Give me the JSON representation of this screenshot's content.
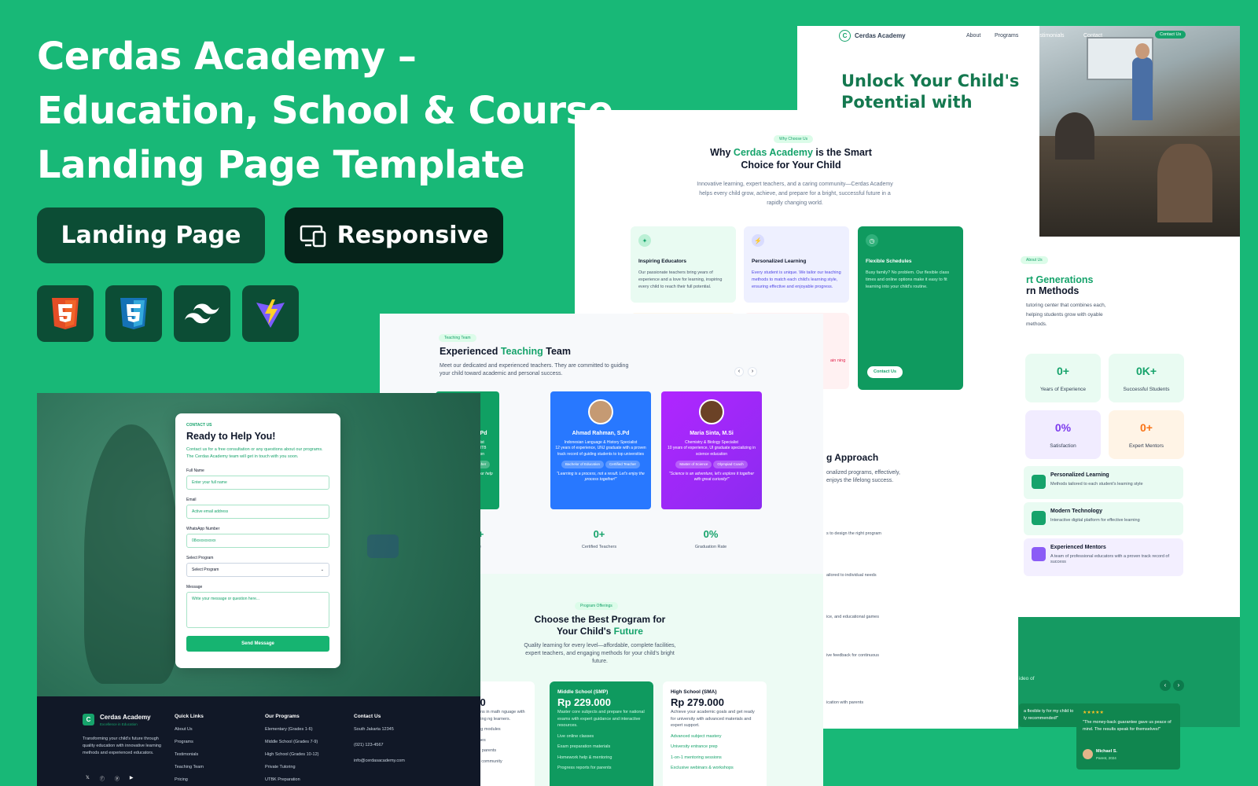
{
  "hero": {
    "title": "Cerdas Academy – Education, School & Course Landing Page Template",
    "badge_landing": "Landing Page",
    "badge_responsive": "Responsive"
  },
  "tech_icons": [
    "html5-icon",
    "css3-icon",
    "tailwind-icon",
    "vite-icon"
  ],
  "colors": {
    "brand": "#18b877",
    "dark_green": "#0c4d35",
    "accent": "#16a36b"
  },
  "site": {
    "brand": "Cerdas Academy",
    "tagline": "Excellence in Education",
    "nav": [
      "About",
      "Programs",
      "Testimonials",
      "Contact"
    ],
    "contact_btn": "Contact Us",
    "headline": "Unlock Your Child's Potential with"
  },
  "about": {
    "tag": "About Us",
    "title_a": "rt Generations",
    "title_b": "rn Methods",
    "desc": "tutoring center that combines each, helping students grow with oyable methods.",
    "stats": [
      {
        "value": "0+",
        "label": "Years of Experience"
      },
      {
        "value": "0K+",
        "label": "Successful Students"
      },
      {
        "value": "0%",
        "label": "Satisfaction"
      },
      {
        "value": "0+",
        "label": "Expert Mentors"
      }
    ],
    "features": [
      {
        "title": "Personalized Learning",
        "desc": "Methods tailored to each student's learning style"
      },
      {
        "title": "Modern Technology",
        "desc": "Interactive digital platform for effective learning"
      },
      {
        "title": "Experienced Mentors",
        "desc": "A team of professional educators with a proven track record of success"
      }
    ]
  },
  "why": {
    "tag": "Why Choose Us",
    "title_pre": "Why ",
    "title_brand": "Cerdas Academy",
    "title_post": " is the Smart",
    "title_line2": "Choice for Your Child",
    "desc": "Innovative learning, expert teachers, and a caring community—Cerdas Academy helps every child grow, achieve, and prepare for a bright, successful future in a rapidly changing world.",
    "cards": [
      {
        "title": "Inspiring Educators",
        "desc": "Our passionate teachers bring years of experience and a love for learning, inspiring every child to reach their full potential."
      },
      {
        "title": "Personalized Learning",
        "desc": "Every student is unique. We tailor our teaching methods to match each child's learning style, ensuring effective and enjoyable progress."
      },
      {
        "title": "Flexible Schedules",
        "desc": "Busy family? No problem. Our flexible class times and online options make it easy to fit learning into your child's routine."
      }
    ],
    "contact_btn": "Contact Us",
    "approach_title": "g Approach",
    "approach_desc": "onalized programs, effectively, enjoys the lifelong success.",
    "approach_items": [
      "s to design the right program",
      "ailored to individual needs",
      "ice, and educational games",
      "ive feedback for continuous",
      "ication with parents"
    ],
    "partial_text": "ain ning",
    "testimonial_left": "ideo of"
  },
  "testimonials": {
    "stars": "★★★★★",
    "quote": "\"The money-back guarantee gave us peace of mind. The results speak for themselves!\"",
    "author": "Michael S.",
    "role": "Parent, 2024",
    "partial_quote": "a flexible ty for my child to ly recommended!\""
  },
  "team": {
    "tag": "Teaching Team",
    "title_pre": "Experienced ",
    "title_hl": "Teaching",
    "title_post": " Team",
    "desc": "Meet our dedicated and experienced teachers. They are committed to guiding your child toward academic and personal success.",
    "members": [
      {
        "name": "n Johnson, M.Pd",
        "role": "s & Physics Specialist",
        "bio": "eaching experience, ITB doctorate in education",
        "tags": [
          "ster",
          "Certified Teacher"
        ],
        "quote": "extraordinary potential; our help them discover it!\""
      },
      {
        "name": "Ahmad Rahman, S.Pd",
        "role": "Indonesian Language & History Specialist",
        "bio": "12 years of experience, UNJ graduate with a proven track record of guiding students to top universities",
        "tags": [
          "Bachelor of Education",
          "Certified Teacher"
        ],
        "quote": "\"Learning is a process, not a result. Let's enjoy the process together!\""
      },
      {
        "name": "Maria Sinta, M.Si",
        "role": "Chemistry & Biology Specialist",
        "bio": "10 years of experience, UI graduate specializing in science education",
        "tags": [
          "Master of Science",
          "Olympiad Coach"
        ],
        "quote": "\"Science is an adventure, let's explore it together with great curiosity!\""
      }
    ],
    "stats": [
      {
        "value": "0+",
        "label": "s of Experience"
      },
      {
        "value": "0+",
        "label": "Certified Teachers"
      },
      {
        "value": "0%",
        "label": "Graduation Rate"
      }
    ]
  },
  "programs": {
    "tag": "Program Offerings",
    "title_a": "Choose the Best Program for",
    "title_b_pre": "Your Child's ",
    "title_b_hl": "Future",
    "desc": "Quality learning for every level—affordable, complete facilities, expert teachers, and engaging methods for your child's bright future.",
    "cards": [
      {
        "title": "D)",
        "price": "000",
        "desc": "ndations in math nguage with engaging ng learners.",
        "items": [
          "earning modules",
          "& games",
          "ing for parents",
          "online community"
        ]
      },
      {
        "title": "Middle School (SMP)",
        "price": "Rp 229.000",
        "desc": "Master core subjects and prepare for national exams with expert guidance and interactive resources.",
        "items": [
          "Live online classes",
          "Exam preparation materials",
          "Homework help & mentoring",
          "Progress reports for parents"
        ]
      },
      {
        "title": "High School (SMA)",
        "price": "Rp 279.000",
        "desc": "Achieve your academic goals and get ready for university with advanced materials and expert support.",
        "items": [
          "Advanced subject mastery",
          "University entrance prep",
          "1-on-1 mentoring sessions",
          "Exclusive webinars & workshops"
        ]
      }
    ]
  },
  "contact": {
    "tag": "CONTACT US",
    "title": "Ready to Help You!",
    "desc": "Contact us for a free consultation or any questions about our programs. The Cerdas Academy team will get in touch with you soon.",
    "fields": [
      {
        "label": "Full Name",
        "placeholder": "Enter your full name"
      },
      {
        "label": "Email",
        "placeholder": "Active email address"
      },
      {
        "label": "WhatsApp Number",
        "placeholder": "08xxxxxxxxxx"
      }
    ],
    "select_label": "Select Program",
    "select_value": "Select Program",
    "message_label": "Message",
    "message_placeholder": "Write your message or question here...",
    "submit": "Send Message"
  },
  "footer": {
    "about": "Transforming your child's future through quality education with innovative learning methods and experienced educators.",
    "quick_title": "Quick Links",
    "quick": [
      "About Us",
      "Programs",
      "Testimonials",
      "Teaching Team",
      "Pricing"
    ],
    "programs_title": "Our Programs",
    "programs": [
      "Elementary (Grades 1-6)",
      "Middle School (Grades 7-9)",
      "High School (Grades 10-12)",
      "Private Tutoring",
      "UTBK Preparation"
    ],
    "contact_title": "Contact Us",
    "contact": [
      "South Jakarta 12345",
      "(021) 123-4567",
      "info@cerdasacademy.com"
    ]
  }
}
